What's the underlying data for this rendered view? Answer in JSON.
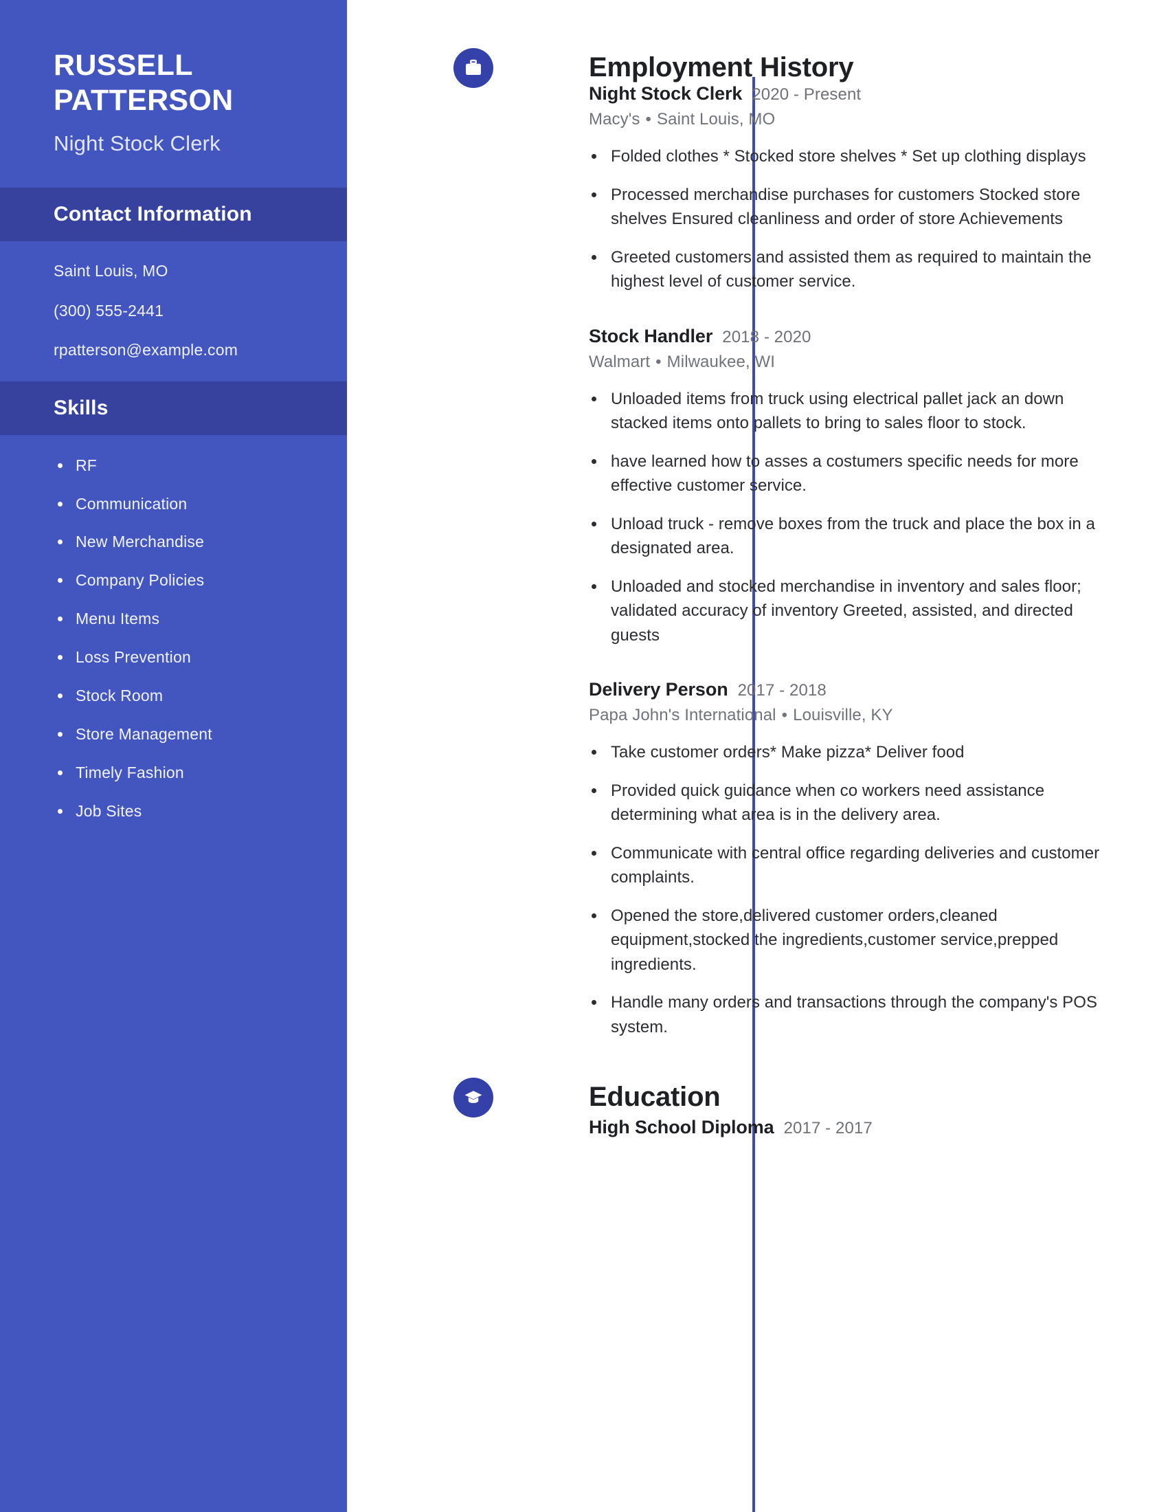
{
  "theme": {
    "sidebar_bg": "#4355bf",
    "sidebar_header_bg": "#36429e",
    "accent": "#3341a8",
    "timeline": "#3c4bb5",
    "text_dark": "#1f2023",
    "text_muted": "#71737a",
    "page_bg": "#ffffff"
  },
  "sidebar": {
    "name": "RUSSELL\nPATTERSON",
    "subtitle": "Night Stock Clerk",
    "contact_heading": "Contact Information",
    "contact": [
      "Saint Louis, MO",
      "(300) 555-2441",
      "rpatterson@example.com"
    ],
    "skills_heading": "Skills",
    "skills": [
      "RF",
      "Communication",
      "New Merchandise",
      "Company Policies",
      "Menu Items",
      "Loss Prevention",
      "Stock Room",
      "Store Management",
      "Timely Fashion",
      "Job Sites"
    ]
  },
  "employment": {
    "heading": "Employment History",
    "icon": "briefcase-icon",
    "entries": [
      {
        "title": "Night Stock Clerk",
        "dates": "2020 - Present",
        "company": "Macy's",
        "location": "Saint Louis, MO",
        "bullets": [
          "Folded clothes * Stocked store shelves * Set up clothing displays",
          "Processed merchandise purchases for customers Stocked store shelves Ensured cleanliness and order of store Achievements",
          "Greeted customers and assisted them as required to maintain the highest level of customer service."
        ]
      },
      {
        "title": "Stock Handler",
        "dates": "2018 - 2020",
        "company": "Walmart",
        "location": "Milwaukee, WI",
        "bullets": [
          "Unloaded items from truck using electrical pallet jack an down stacked items onto pallets to bring to sales floor to stock.",
          "have learned how to asses a costumers specific needs for more effective customer service.",
          "Unload truck - remove boxes from the truck and place the box in a designated area.",
          "Unloaded and stocked merchandise in inventory and sales floor; validated accuracy of inventory Greeted, assisted, and directed guests"
        ]
      },
      {
        "title": "Delivery Person",
        "dates": "2017 - 2018",
        "company": "Papa John's International",
        "location": "Louisville, KY",
        "bullets": [
          "Take customer orders* Make pizza* Deliver food",
          "Provided quick guidance when co workers need assistance determining what area is in the delivery area.",
          "Communicate with central office regarding deliveries and customer complaints.",
          "Opened the store,delivered customer orders,cleaned equipment,stocked the ingredients,customer service,prepped ingredients.",
          "Handle many orders and transactions through the company's POS system."
        ]
      }
    ]
  },
  "education": {
    "heading": "Education",
    "icon": "graduation-cap-icon",
    "entries": [
      {
        "title": "High School Diploma",
        "dates": "2017 - 2017"
      }
    ]
  }
}
